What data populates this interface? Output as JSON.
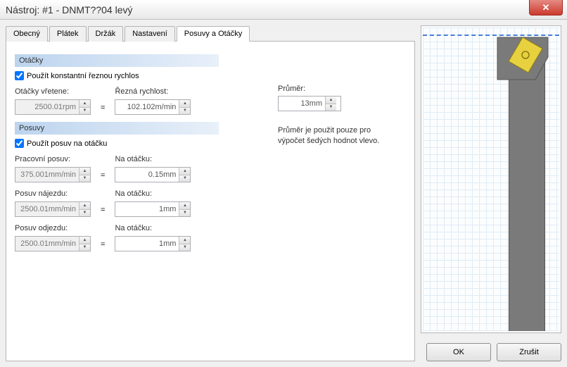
{
  "window": {
    "title": "Nástroj: #1 - DNMT??04 levý"
  },
  "tabs": {
    "items": [
      "Obecný",
      "Plátek",
      "Držák",
      "Nastavení",
      "Posuvy a Otáčky"
    ],
    "active": 4
  },
  "sections": {
    "spindle_header": "Otáčky",
    "feeds_header": "Posuvy"
  },
  "spindle": {
    "useConstantSpeedLabel": "Použít konstantní řeznou rychlos",
    "useConstantSpeed": true,
    "rpmLabel": "Otáčky vřetene:",
    "rpmValue": "2500.01rpm",
    "cuttingSpeedLabel": "Řezná rychlost:",
    "cuttingSpeedValue": "102.102m/min"
  },
  "feeds": {
    "usePerRevLabel": "Použít posuv na otáčku",
    "usePerRev": true,
    "workFeedLabel": "Pracovní posuv:",
    "workFeedValue": "375.001mm/min",
    "perRevLabel": "Na otáčku:",
    "workPerRev": "0.15mm",
    "approachLabel": "Posuv nájezdu:",
    "approachValue": "2500.01mm/min",
    "approachPerRev": "1mm",
    "retractLabel": "Posuv odjezdu:",
    "retractValue": "2500.01mm/min",
    "retractPerRev": "1mm"
  },
  "diameter": {
    "label": "Průměr:",
    "value": "13mm",
    "note": "Průměr je použit pouze pro výpočet šedých hodnot vlevo."
  },
  "buttons": {
    "ok": "OK",
    "cancel": "Zrušit"
  },
  "eq": "="
}
